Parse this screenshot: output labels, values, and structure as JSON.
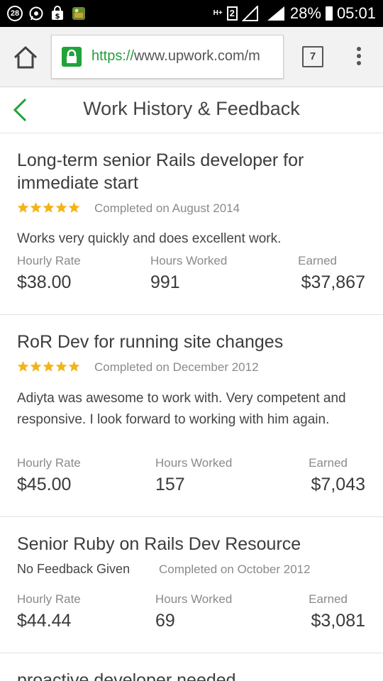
{
  "status_bar": {
    "notification_count": "28",
    "network": "H+",
    "sim": "2",
    "battery": "28%",
    "time": "05:01"
  },
  "browser": {
    "url_scheme": "https://",
    "url_rest": "www.upwork.com/m",
    "tab_count": "7"
  },
  "page": {
    "title": "Work History & Feedback"
  },
  "jobs": [
    {
      "title": "Long-term senior Rails developer for immediate start",
      "rating": 5,
      "completed": "Completed on August 2014",
      "comment": "Works very quickly and does excellent work.",
      "hourly_label": "Hourly Rate",
      "hourly": "$38.00",
      "hours_label": "Hours Worked",
      "hours": "991",
      "earned_label": "Earned",
      "earned": "$37,867"
    },
    {
      "title": "RoR Dev for running site changes",
      "rating": 5,
      "completed": "Completed on December 2012",
      "comment": "Adiyta was awesome to work with. Very competent and responsive. I look forward to working with him again.",
      "hourly_label": "Hourly Rate",
      "hourly": "$45.00",
      "hours_label": "Hours Worked",
      "hours": "157",
      "earned_label": "Earned",
      "earned": "$7,043"
    },
    {
      "title": "Senior Ruby on Rails Dev Resource",
      "feedback": "No Feedback Given",
      "completed": "Completed on October 2012",
      "hourly_label": "Hourly Rate",
      "hourly": "$44.44",
      "hours_label": "Hours Worked",
      "hours": "69",
      "earned_label": "Earned",
      "earned": "$3,081"
    },
    {
      "title": "proactive developer needed"
    }
  ],
  "colors": {
    "accent": "#1fa03a",
    "star": "#f2b418"
  }
}
